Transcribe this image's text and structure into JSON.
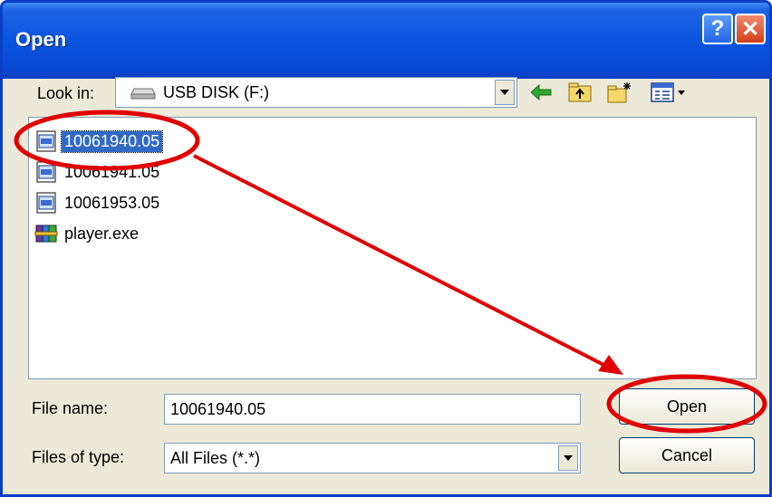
{
  "window": {
    "title": "Open",
    "help_label": "?",
    "close_label": "✕"
  },
  "lookin": {
    "label": "Look in:",
    "location": "USB DISK (F:)"
  },
  "toolbar": {
    "icons": [
      "back-arrow-icon",
      "up-folder-icon",
      "new-folder-icon",
      "view-menu-icon"
    ]
  },
  "files": [
    {
      "name": "10061940.05",
      "icon": "document-icon",
      "selected": true
    },
    {
      "name": "10061941.05",
      "icon": "document-icon",
      "selected": false
    },
    {
      "name": "10061953.05",
      "icon": "document-icon",
      "selected": false
    },
    {
      "name": "player.exe",
      "icon": "archive-icon",
      "selected": false
    }
  ],
  "form": {
    "file_name_label": "File name:",
    "file_name_value": "10061940.05",
    "file_type_label": "Files of type:",
    "file_type_value": "All Files (*.*)"
  },
  "buttons": {
    "open_label": "Open",
    "cancel_label": "Cancel"
  },
  "colors": {
    "titlebar": "#0a55e0",
    "selection": "#316ac5",
    "annotation": "#e00000"
  }
}
